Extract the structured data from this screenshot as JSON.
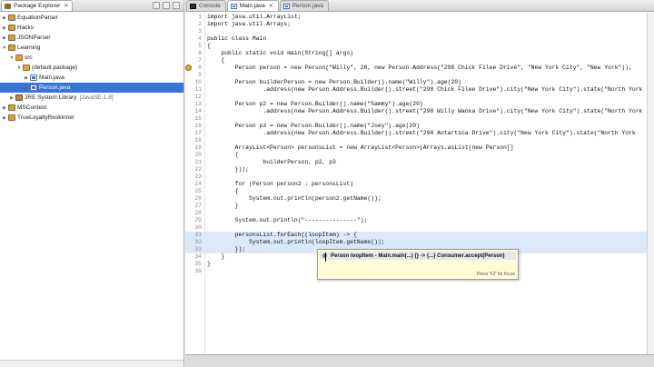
{
  "explorer": {
    "tab_label": "Package Explorer",
    "items": [
      {
        "label": "EquationParser",
        "depth": 0,
        "expanded": false,
        "kind": "project"
      },
      {
        "label": "Hacks",
        "depth": 0,
        "expanded": false,
        "kind": "project"
      },
      {
        "label": "JSONParser",
        "depth": 0,
        "expanded": false,
        "kind": "project"
      },
      {
        "label": "Learning",
        "depth": 0,
        "expanded": true,
        "kind": "project"
      },
      {
        "label": "src",
        "depth": 1,
        "expanded": true,
        "kind": "src"
      },
      {
        "label": "(default package)",
        "depth": 2,
        "expanded": true,
        "kind": "pkg"
      },
      {
        "label": "Main.java",
        "depth": 3,
        "expanded": false,
        "kind": "java"
      },
      {
        "label": "Person.java",
        "depth": 3,
        "expanded": false,
        "kind": "java",
        "selected": true
      },
      {
        "label": "JRE System Library",
        "suffix": "[JavaSE-1.8]",
        "depth": 1,
        "expanded": false,
        "kind": "jre"
      },
      {
        "label": "MSContest",
        "depth": 0,
        "expanded": false,
        "kind": "project"
      },
      {
        "label": "TrueLoyaltyReskinner",
        "depth": 0,
        "expanded": false,
        "kind": "project"
      }
    ]
  },
  "editor": {
    "tabs": [
      {
        "label": "Console",
        "icon": "console-icon",
        "active": false
      },
      {
        "label": "Main.java",
        "icon": "java-file-icon",
        "active": true
      },
      {
        "label": "Person.java",
        "icon": "java-file-icon",
        "active": false
      }
    ],
    "lines": [
      {
        "n": "1",
        "t": "import java.util.ArrayList;"
      },
      {
        "n": "2",
        "t": "import java.util.Arrays;"
      },
      {
        "n": "3",
        "t": ""
      },
      {
        "n": "4",
        "t": "public class Main"
      },
      {
        "n": "5",
        "t": "{"
      },
      {
        "n": "6",
        "t": "    public static void main(String[] args)"
      },
      {
        "n": "7",
        "t": "    {"
      },
      {
        "n": "8",
        "t": "        Person person = new Person(\"Willy\", 20, new Person.Address(\"298 Chick Filee Drive\", \"New York City\", \"New York\"));"
      },
      {
        "n": "9",
        "t": ""
      },
      {
        "n": "10",
        "t": "        Person builderPerson = new Person.Builder().name(\"Willy\").age(20)"
      },
      {
        "n": "11",
        "t": "                .address(new Person.Address.Builder().street(\"298 Chick Filee Drive\").city(\"New York City\").state(\"North York"
      },
      {
        "n": "12",
        "t": ""
      },
      {
        "n": "13",
        "t": "        Person p2 = new Person.Builder().name(\"Sammy\").age(20)"
      },
      {
        "n": "14",
        "t": "                .address(new Person.Address.Builder().street(\"298 Willy Wanka Drive\").city(\"New York City\").state(\"North York"
      },
      {
        "n": "15",
        "t": ""
      },
      {
        "n": "16",
        "t": "        Person p3 = new Person.Builder().name(\"Joey\").age(20)"
      },
      {
        "n": "17",
        "t": "                .address(new Person.Address.Builder().street(\"298 Antartica Drive\").city(\"New York City\").state(\"North York"
      },
      {
        "n": "18",
        "t": ""
      },
      {
        "n": "19",
        "t": "        ArrayList<Person> personsList = new ArrayList<Person>(Arrays.asList(new Person[]"
      },
      {
        "n": "20",
        "t": "        {"
      },
      {
        "n": "21",
        "t": "                builderPerson, p2, p3"
      },
      {
        "n": "22",
        "t": "        }));"
      },
      {
        "n": "23",
        "t": ""
      },
      {
        "n": "24",
        "t": "        for (Person person2 : personsList)"
      },
      {
        "n": "25",
        "t": "        {"
      },
      {
        "n": "26",
        "t": "            System.out.println(person2.getName());"
      },
      {
        "n": "27",
        "t": "        }"
      },
      {
        "n": "28",
        "t": ""
      },
      {
        "n": "29",
        "t": "        System.out.println(\"---------------\");"
      },
      {
        "n": "30",
        "t": ""
      },
      {
        "n": "31",
        "t": "        personsList.forEach((loopItem) -> {"
      },
      {
        "n": "32",
        "t": "            System.out.println(loopItem.getName());"
      },
      {
        "n": "33",
        "t": "        });"
      },
      {
        "n": "34",
        "t": "    }"
      },
      {
        "n": "35",
        "t": "}"
      },
      {
        "n": "36",
        "t": ""
      }
    ],
    "highlighted_lines": [
      "31",
      "32",
      "33"
    ],
    "warning_lines": [
      "8"
    ]
  },
  "tooltip": {
    "signature": "Person loopItem - Main.main(...) {} -> {...} Consumer.accept(Person)",
    "footer": "Press 'F2' for focus"
  }
}
